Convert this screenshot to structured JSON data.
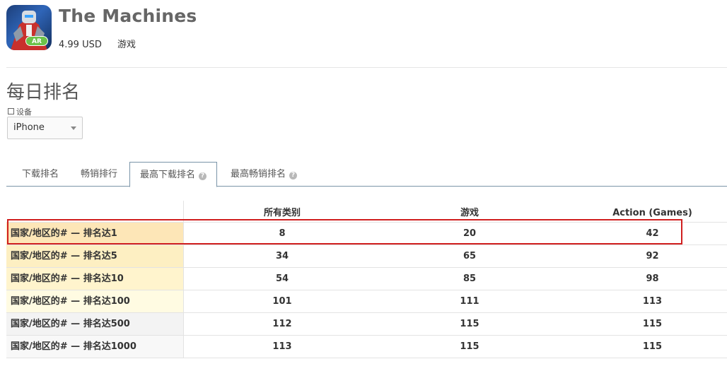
{
  "app": {
    "title": "The Machines",
    "price": "4.99 USD",
    "category": "游戏",
    "icon_badge": "AR"
  },
  "section": {
    "title": "每日排名",
    "device_label": "设备",
    "device_selected": "iPhone"
  },
  "tabs": [
    {
      "label": "下载排名",
      "active": false,
      "help": false
    },
    {
      "label": "畅销排行",
      "active": false,
      "help": false
    },
    {
      "label": "最高下载排名",
      "active": true,
      "help": true
    },
    {
      "label": "最高畅销排名",
      "active": false,
      "help": true
    }
  ],
  "table": {
    "columns": [
      "所有类别",
      "游戏",
      "Action (Games)"
    ],
    "rows": [
      {
        "label": "国家/地区的# — 排名达1",
        "values": [
          "8",
          "20",
          "42"
        ],
        "color": "#fde6b7"
      },
      {
        "label": "国家/地区的# — 排名达5",
        "values": [
          "34",
          "65",
          "92"
        ],
        "color": "#fdefc2"
      },
      {
        "label": "国家/地区的# — 排名达10",
        "values": [
          "54",
          "85",
          "98"
        ],
        "color": "#fff4cd"
      },
      {
        "label": "国家/地区的# — 排名达100",
        "values": [
          "101",
          "111",
          "113"
        ],
        "color": "#fffbe2"
      },
      {
        "label": "国家/地区的# — 排名达500",
        "values": [
          "112",
          "115",
          "115"
        ],
        "color": "#f3f3f3"
      },
      {
        "label": "国家/地区的# — 排名达1000",
        "values": [
          "113",
          "115",
          "115"
        ],
        "color": "#f8f8f8"
      }
    ]
  },
  "colors": {
    "highlight_border": "#d01f1f",
    "tab_border": "#7a95a8"
  }
}
